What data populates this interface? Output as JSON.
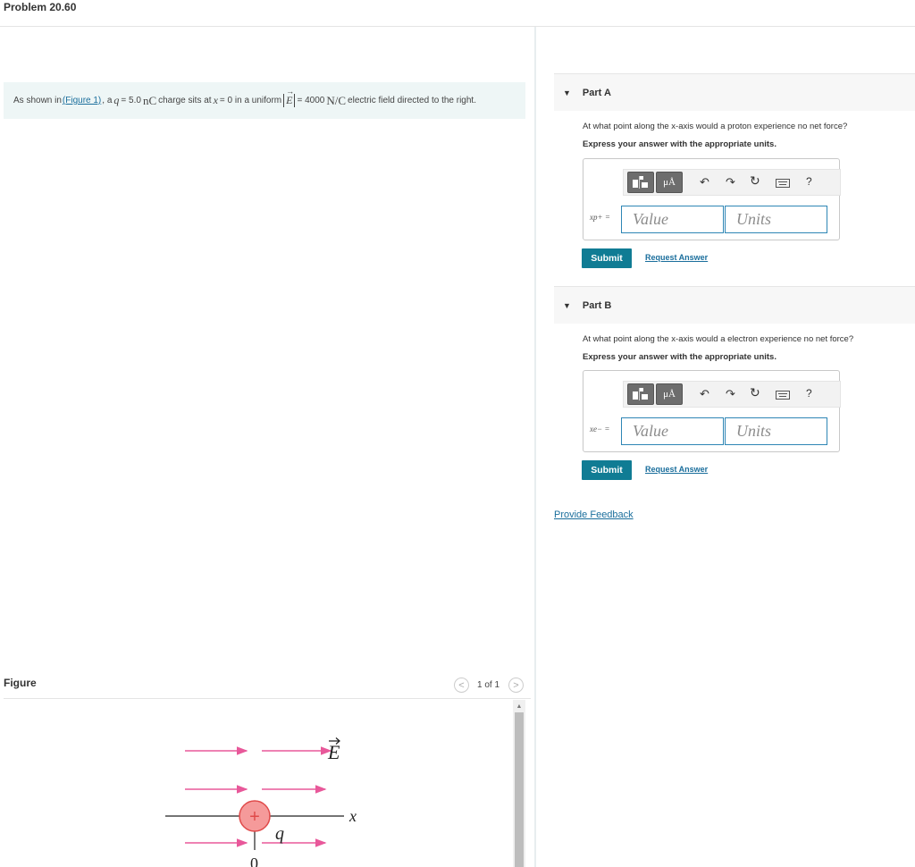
{
  "page": {
    "title": "Problem 20.60"
  },
  "problem": {
    "intro": "As shown in ",
    "figure_link": "(Figure 1)",
    "t1": ", a ",
    "q_sym": "q",
    "t2": " = 5.0 ",
    "charge_unit": "nC",
    "t3": " charge sits at ",
    "x_sym": "x",
    "t4": " = 0 in a uniform ",
    "E_sym": "E",
    "t5": " = 4000 ",
    "field_unit": "N/C",
    "t6": " electric field directed to the right."
  },
  "toolbar": {
    "units_label": "μÅ",
    "undo_icon": "undo-arrow-icon",
    "redo_icon": "redo-arrow-icon",
    "reset_icon": "reset-icon",
    "keyboard_icon": "keyboard-icon",
    "help_label": "?"
  },
  "parts": [
    {
      "label": "Part A",
      "question": "At what point along the x-axis would a proton experience no net force?",
      "instruction": "Express your answer with the appropriate units.",
      "var_label": "xp+ =",
      "value_placeholder": "Value",
      "units_placeholder": "Units",
      "submit_label": "Submit",
      "request_label": "Request Answer"
    },
    {
      "label": "Part B",
      "question": "At what point along the x-axis would a electron experience no net force?",
      "instruction": "Express your answer with the appropriate units.",
      "var_label": "xe− =",
      "value_placeholder": "Value",
      "units_placeholder": "Units",
      "submit_label": "Submit",
      "request_label": "Request Answer"
    }
  ],
  "feedback_label": "Provide Feedback",
  "figure": {
    "title": "Figure",
    "pager": "1 of 1",
    "prev_label": "<",
    "next_label": ">",
    "field_label": "E",
    "axis_label": "x",
    "charge_label": "q",
    "plus_label": "+",
    "origin_label": "0"
  },
  "colors": {
    "accent": "#107c94",
    "link": "#1a6e9c",
    "field_lines": "#e8589a",
    "charge_fill": "#f59a9a",
    "charge_stroke": "#e04a4a"
  }
}
